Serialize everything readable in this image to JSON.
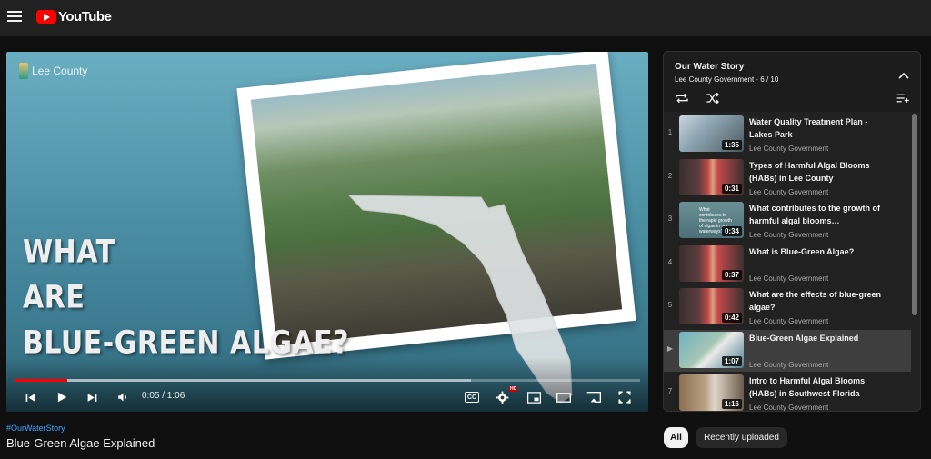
{
  "header": {
    "logo_text": "YouTube"
  },
  "player": {
    "channel_watermark": "Lee County",
    "headline": [
      "WHAT",
      "ARE",
      "BLUE-GREEN ALGAE?"
    ],
    "time_display": "0:05 / 1:06",
    "progress_fraction": 0.085,
    "loaded_fraction": 0.73
  },
  "video": {
    "hashtag": "#OurWaterStory",
    "title": "Blue-Green Algae Explained"
  },
  "playlist": {
    "title": "Our Water Story",
    "channel": "Lee County Government",
    "position": "6 / 10",
    "items": [
      {
        "index": "1",
        "title": "Water Quality Treatment Plan - Lakes Park",
        "channel": "Lee County Government",
        "duration": "1:35",
        "thumb": "park"
      },
      {
        "index": "2",
        "title": "Types of Harmful Algal Blooms (HABs) in Lee County",
        "channel": "Lee County Government",
        "duration": "0:31",
        "thumb": "person"
      },
      {
        "index": "3",
        "title": "What contributes to the growth of harmful algal blooms…",
        "channel": "Lee County Government",
        "duration": "0:34",
        "thumb": "text",
        "thumb_caption": "What contributes to the rapid growth of algae in our waterways?"
      },
      {
        "index": "4",
        "title": "What is Blue-Green Algae?",
        "channel": "Lee County Government",
        "duration": "0:37",
        "thumb": "person"
      },
      {
        "index": "5",
        "title": "What are the effects of blue-green algae?",
        "channel": "Lee County Government",
        "duration": "0:42",
        "thumb": "person"
      },
      {
        "index": "▶",
        "title": "Blue-Green Algae Explained",
        "channel": "Lee County Government",
        "duration": "1:07",
        "thumb": "algae",
        "active": true
      },
      {
        "index": "7",
        "title": "Intro to Harmful Algal Blooms (HABs) in Southwest Florida",
        "channel": "Lee County Government",
        "duration": "1:16",
        "thumb": "office"
      }
    ]
  },
  "chips": {
    "all": "All",
    "recent": "Recently uploaded"
  },
  "icons": {
    "menu": "hamburger-menu-icon",
    "prev": "skip-previous-icon",
    "play": "play-icon",
    "next": "skip-next-icon",
    "volume": "volume-icon",
    "captions": "closed-captions-icon",
    "settings": "gear-icon",
    "miniplayer": "miniplayer-icon",
    "theater": "theater-mode-icon",
    "cast": "cast-icon",
    "fullscreen": "fullscreen-icon",
    "loop": "loop-icon",
    "shuffle": "shuffle-icon",
    "save": "playlist-add-icon",
    "collapse": "chevron-up-icon"
  },
  "colors": {
    "accent": "#ff0000",
    "link": "#3ea6ff",
    "background": "#0f0f0f"
  }
}
